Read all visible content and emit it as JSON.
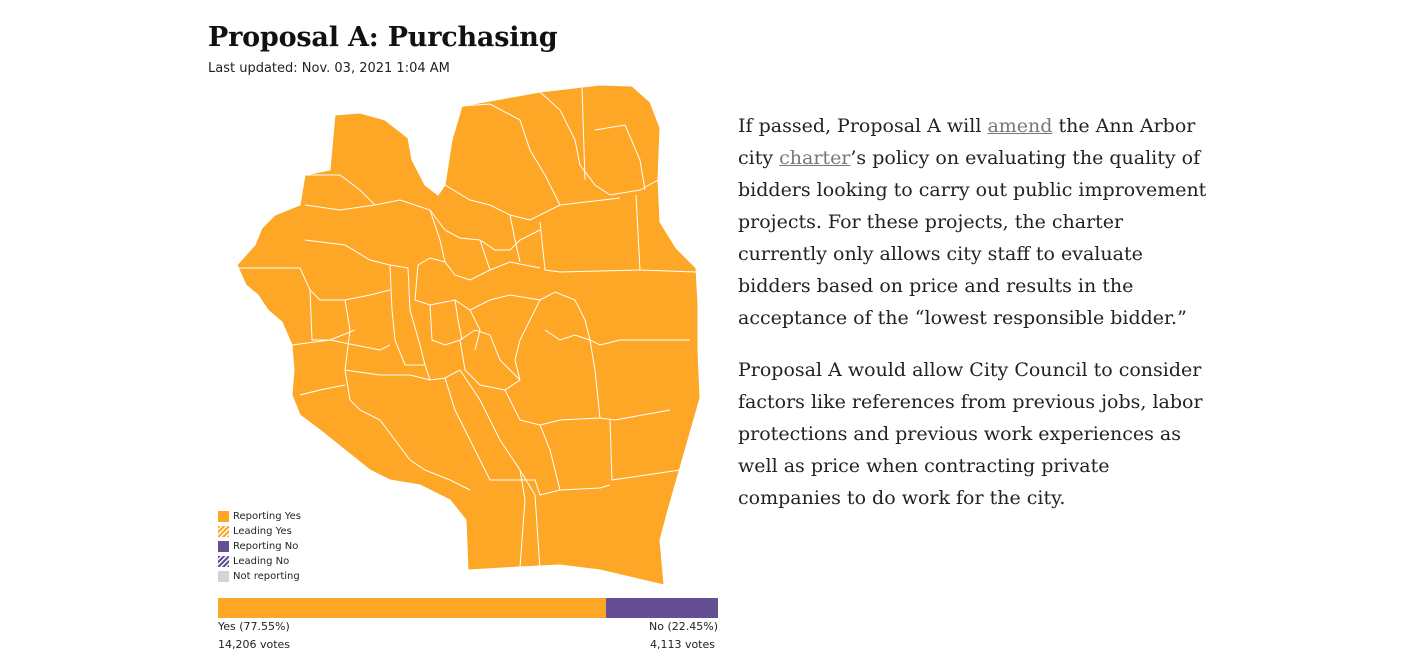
{
  "header": {
    "title": "Proposal A: Purchasing",
    "updated": "Last updated: Nov. 03, 2021 1:04 AM"
  },
  "map": {
    "fill_color": "#fea626",
    "border_color": "#ffffff",
    "precinct_status": "Reporting Yes"
  },
  "legend": [
    {
      "label": "Reporting Yes",
      "color": "#fea626",
      "pattern": "solid"
    },
    {
      "label": "Leading Yes",
      "color": "#fea626",
      "pattern": "hatched"
    },
    {
      "label": "Reporting No",
      "color": "#644e94",
      "pattern": "solid"
    },
    {
      "label": "Leading No",
      "color": "#644e94",
      "pattern": "hatched"
    },
    {
      "label": "Not reporting",
      "color": "#d4d4d4",
      "pattern": "solid"
    }
  ],
  "results": {
    "yes": {
      "label": "Yes (77.55%)",
      "votes": "14,206 votes",
      "percent": 77.55,
      "color": "#fea626"
    },
    "no": {
      "label": "No (22.45%)",
      "votes": "4,113 votes",
      "percent": 22.45,
      "color": "#644e94"
    }
  },
  "article": {
    "p1_a": "If passed, Proposal A will ",
    "p1_link1": "amend",
    "p1_b": " the Ann Arbor city ",
    "p1_link2": "charter",
    "p1_c": "’s policy on evaluating the quality of bidders looking to carry out public improvement projects. For these projects, the charter currently only allows city staff to evaluate bidders based on price and results in the acceptance of the “lowest responsible bidder.”",
    "p2": "Proposal A would allow City Council to consider factors like references from previous jobs, labor protections and previous work experiences as well as price when contracting private companies to do work for the city."
  }
}
